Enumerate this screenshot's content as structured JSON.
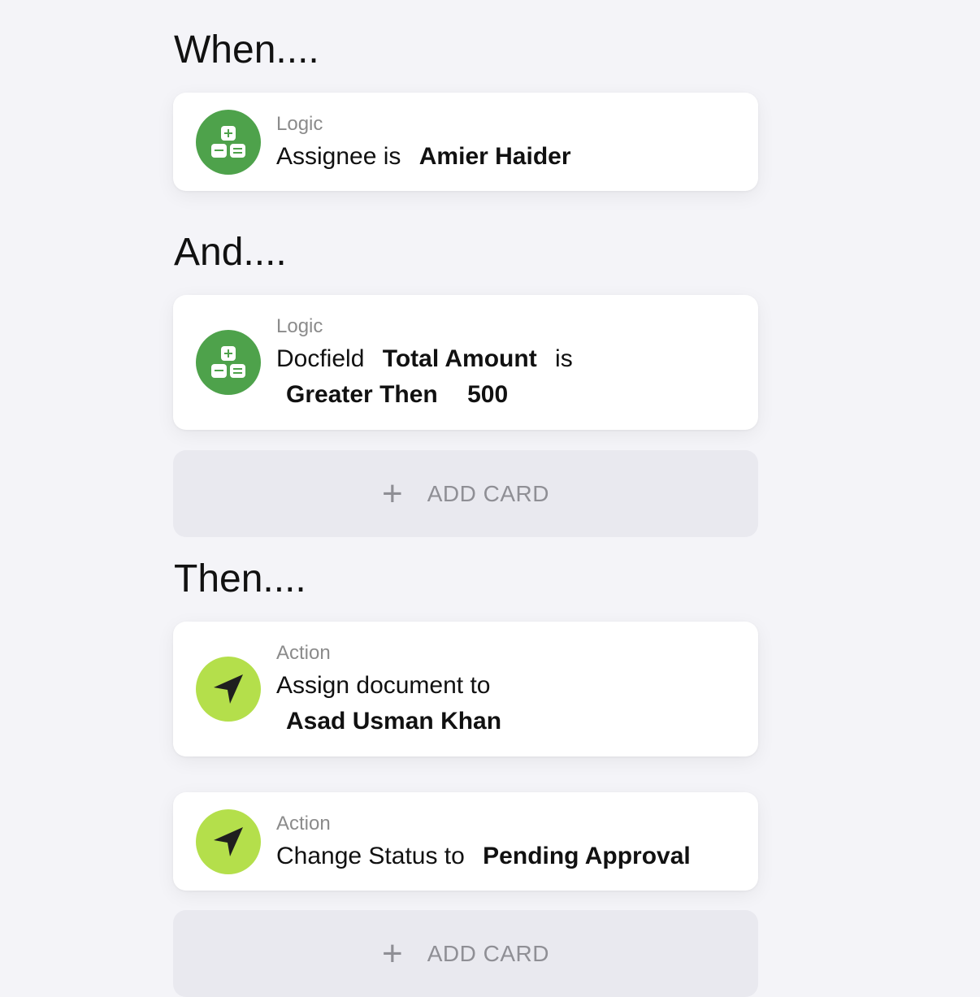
{
  "sections": {
    "when": "When....",
    "and": "And....",
    "then": "Then...."
  },
  "cards": {
    "c1": {
      "kind": "Logic",
      "text1": "Assignee is",
      "value1": "Amier Haider"
    },
    "c2": {
      "kind": "Logic",
      "text1": "Docfield",
      "value1": "Total Amount",
      "text2": "is",
      "value2": "Greater Then",
      "value3": "500"
    },
    "c3": {
      "kind": "Action",
      "text1": "Assign document to",
      "value1": "Asad Usman Khan"
    },
    "c4": {
      "kind": "Action",
      "text1": "Change Status to",
      "value1": "Pending Approval"
    }
  },
  "add_card": {
    "label": "ADD CARD",
    "icon": "plus-icon"
  },
  "colors": {
    "logic": "#4ea24b",
    "action": "#b4df4b",
    "add_bg": "#e9e9ef"
  }
}
